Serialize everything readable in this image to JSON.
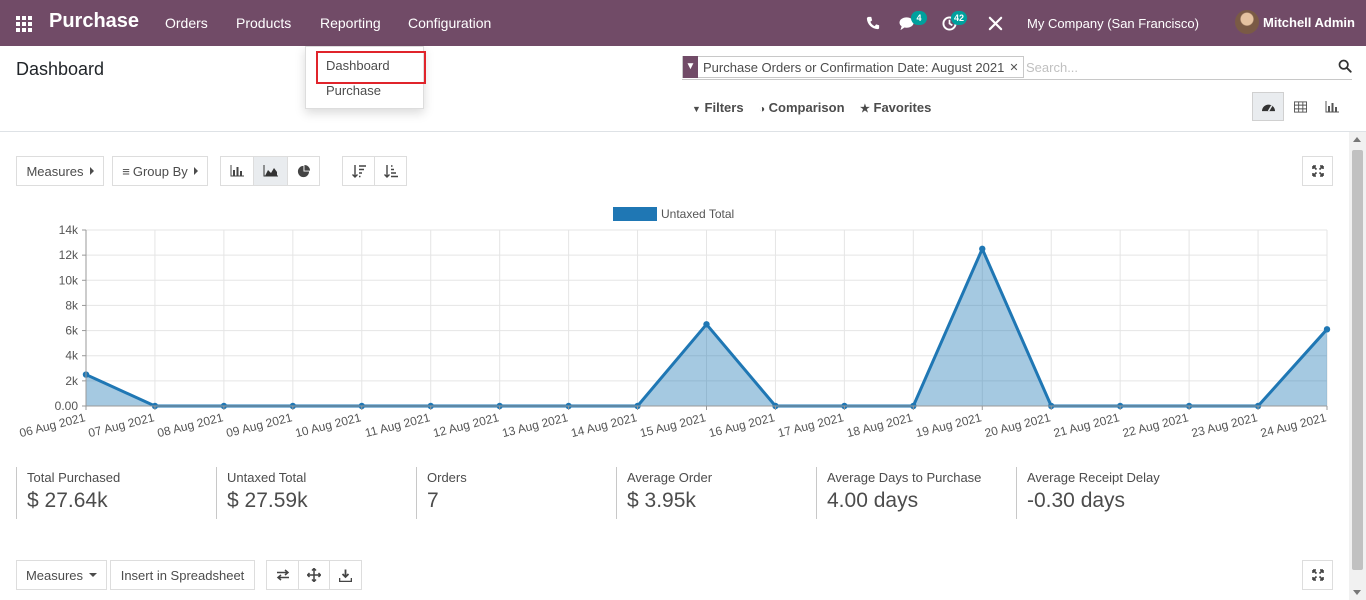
{
  "navbar": {
    "brand": "Purchase",
    "menu": [
      "Orders",
      "Products",
      "Reporting",
      "Configuration"
    ],
    "messages_count": "4",
    "activities_count": "42",
    "company": "My Company (San Francisco)",
    "user": "Mitchell Admin"
  },
  "reporting_menu": {
    "items": [
      "Dashboard",
      "Purchase"
    ],
    "selected": "Dashboard"
  },
  "page_title": "Dashboard",
  "search": {
    "facet": "Purchase Orders or Confirmation Date: August 2021",
    "placeholder": "Search..."
  },
  "filters": {
    "filters_label": "Filters",
    "comparison_label": "Comparison",
    "favorites_label": "Favorites"
  },
  "views": {
    "active": "dashboard",
    "available": [
      "dashboard",
      "pivot",
      "graph"
    ]
  },
  "graph_toolbar": {
    "measures_label": "Measures",
    "group_by_label": "Group By",
    "active_chart": "area"
  },
  "chart_data": {
    "type": "area",
    "series": [
      {
        "name": "Untaxed Total",
        "values": [
          2500,
          0,
          0,
          0,
          0,
          0,
          0,
          0,
          0,
          6500,
          0,
          0,
          0,
          12500,
          0,
          0,
          0,
          0,
          6100
        ]
      }
    ],
    "categories": [
      "06 Aug 2021",
      "07 Aug 2021",
      "08 Aug 2021",
      "09 Aug 2021",
      "10 Aug 2021",
      "11 Aug 2021",
      "12 Aug 2021",
      "13 Aug 2021",
      "14 Aug 2021",
      "15 Aug 2021",
      "16 Aug 2021",
      "17 Aug 2021",
      "18 Aug 2021",
      "19 Aug 2021",
      "20 Aug 2021",
      "21 Aug 2021",
      "22 Aug 2021",
      "23 Aug 2021",
      "24 Aug 2021"
    ],
    "yticks": [
      "0.00",
      "2k",
      "4k",
      "6k",
      "8k",
      "10k",
      "12k",
      "14k"
    ],
    "ylim": [
      0,
      14000
    ],
    "grid": true,
    "legend_position": "top-center",
    "color": "#1f77b4"
  },
  "kpis": [
    {
      "label": "Total Purchased",
      "value": "$ 27.64k"
    },
    {
      "label": "Untaxed Total",
      "value": "$ 27.59k"
    },
    {
      "label": "Orders",
      "value": "7"
    },
    {
      "label": "Average Order",
      "value": "$ 3.95k"
    },
    {
      "label": "Average Days to Purchase",
      "value": "4.00 days"
    },
    {
      "label": "Average Receipt Delay",
      "value": "-0.30 days"
    }
  ],
  "pivot_toolbar": {
    "measures_label": "Measures",
    "insert_label": "Insert in Spreadsheet"
  },
  "colors": {
    "navbar": "#714b67",
    "badge": "#00a09d",
    "highlight": "#e0242b",
    "series": "#1f77b4"
  }
}
